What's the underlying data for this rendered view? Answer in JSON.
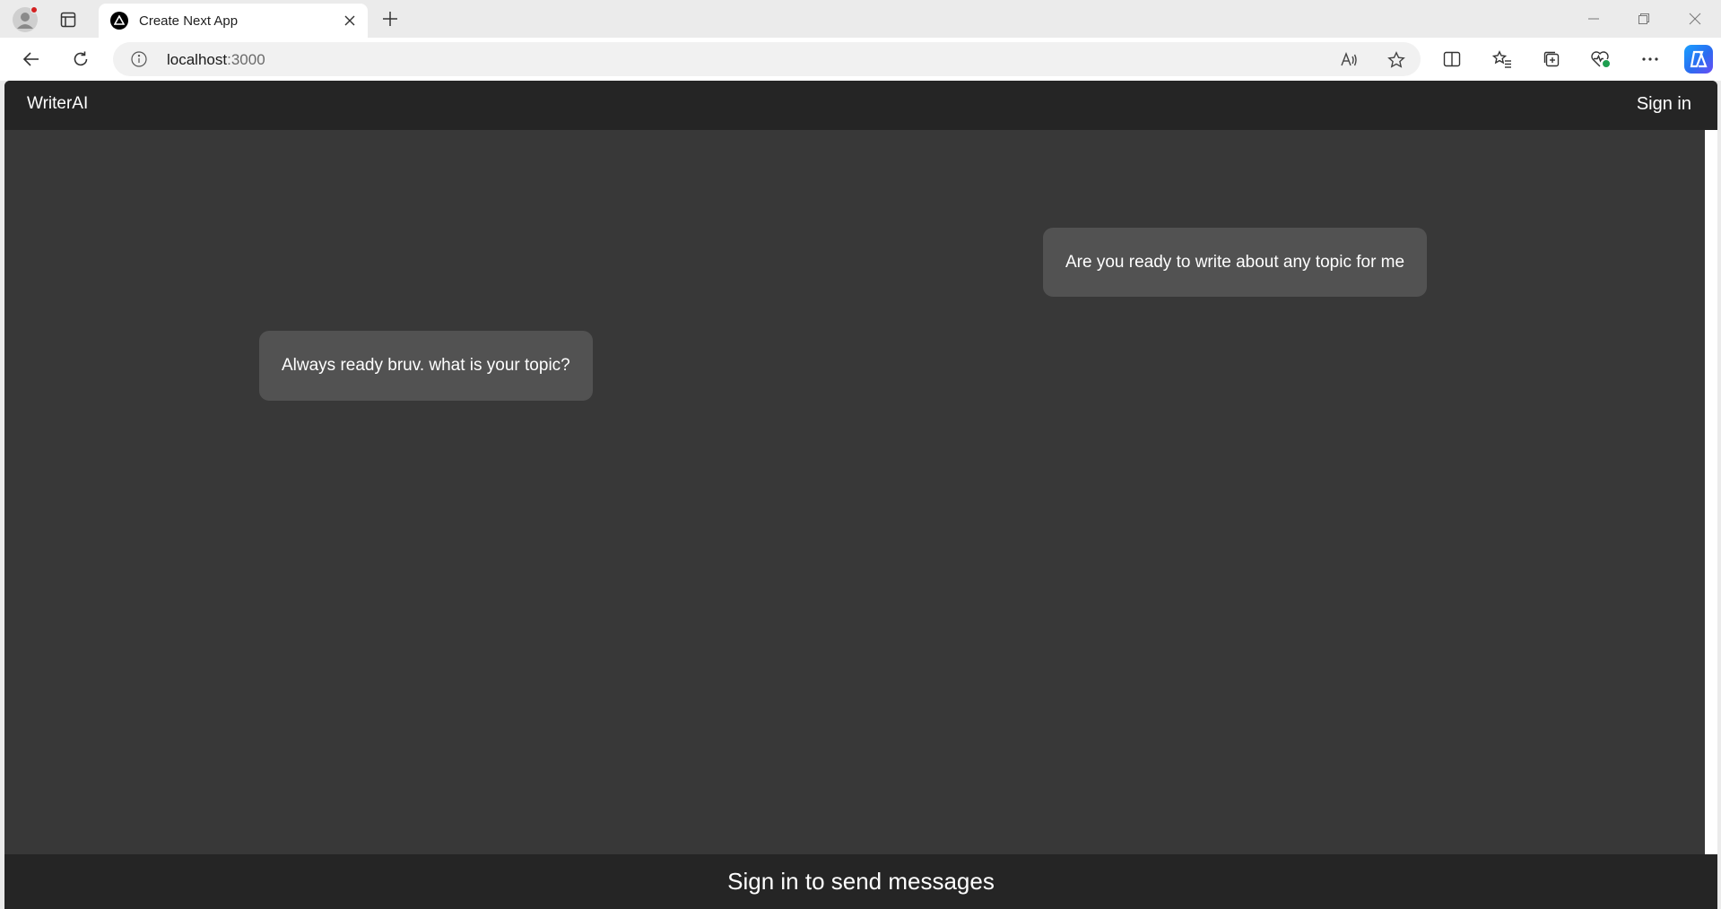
{
  "browser": {
    "tab_title": "Create Next App",
    "url_host": "localhost",
    "url_port": ":3000"
  },
  "app": {
    "brand": "WriterAI",
    "signin_label": "Sign in"
  },
  "messages": [
    {
      "role": "user",
      "text": "Are you ready to write about any topic for me"
    },
    {
      "role": "assistant",
      "text": "Always ready bruv. what is your topic?"
    }
  ],
  "footer": {
    "text": "Sign in to send messages"
  },
  "colors": {
    "page_bg": "#383838",
    "header_bg": "#252525",
    "bubble_bg": "#525252"
  }
}
